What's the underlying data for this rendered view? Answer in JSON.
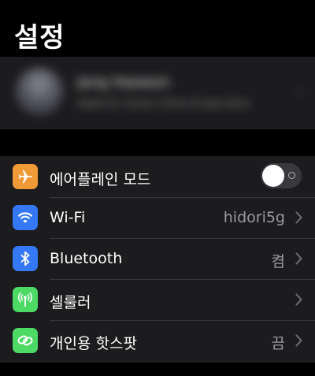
{
  "header": {
    "title": "설정"
  },
  "profile": {
    "name": "Jang Haewon",
    "subtitle": "Apple ID, iCloud, iTunes 및 App Store"
  },
  "settings": {
    "airplane": {
      "label": "에어플레인 모드",
      "icon": "airplane-icon",
      "color": "#f09a37",
      "toggle_state": "off"
    },
    "wifi": {
      "label": "Wi-Fi",
      "value": "hidori5g",
      "icon": "wifi-icon",
      "color": "#3478f6"
    },
    "bluetooth": {
      "label": "Bluetooth",
      "value": "켬",
      "icon": "bluetooth-icon",
      "color": "#3478f6"
    },
    "cellular": {
      "label": "셀룰러",
      "icon": "antenna-icon",
      "color": "#4cd964"
    },
    "hotspot": {
      "label": "개인용 핫스팟",
      "value": "끔",
      "icon": "hotspot-link-icon",
      "color": "#4cd964"
    }
  }
}
